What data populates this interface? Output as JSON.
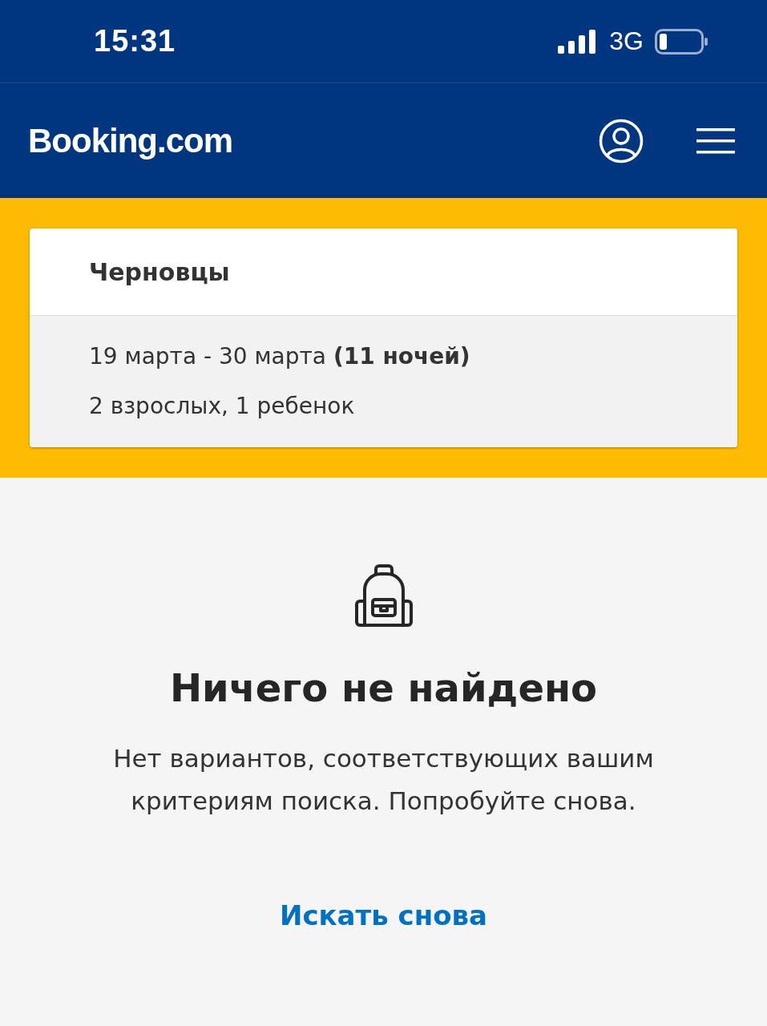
{
  "status_bar": {
    "time": "15:31",
    "network": "3G"
  },
  "header": {
    "logo": "Booking.com"
  },
  "search_summary": {
    "destination": "Черновцы",
    "dates": "19 марта - 30 марта **(11 ночей)**",
    "guests": "2 взрослых, 1 ребенок"
  },
  "empty_state": {
    "title": "Ничего не найдено",
    "message": "Нет вариантов, соответствующих вашим критериям поиска. Попробуйте снова.",
    "action": "Искать снова"
  }
}
